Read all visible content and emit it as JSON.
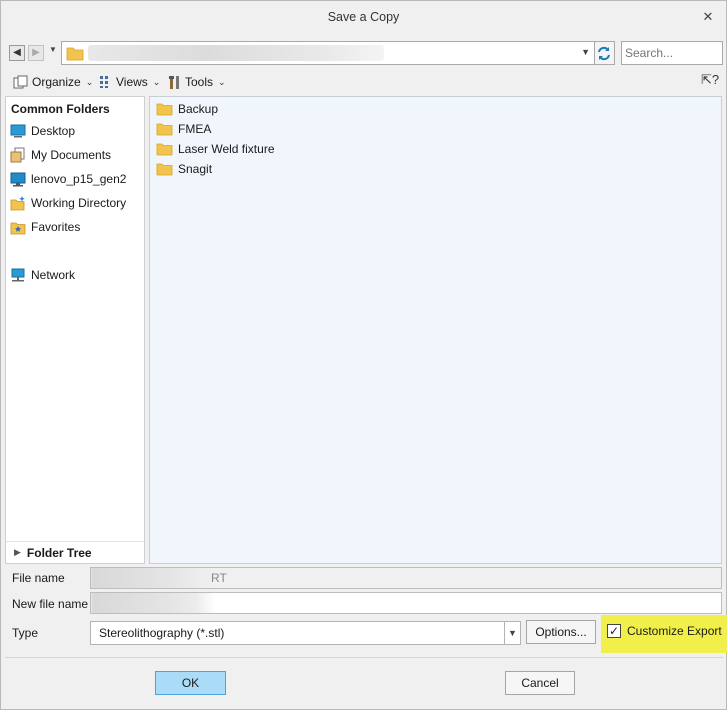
{
  "window": {
    "title": "Save a Copy",
    "close_glyph": "✕"
  },
  "nav": {
    "back_glyph": "◀",
    "forward_glyph": "▶",
    "history_dropdown_glyph": "▼",
    "address_dropdown_glyph": "▼",
    "search_placeholder": "Search..."
  },
  "toolbar": {
    "organize": "Organize",
    "views": "Views",
    "tools": "Tools",
    "chevron": "⌄",
    "help_glyph": "⇱?"
  },
  "left_pane": {
    "heading": "Common Folders",
    "items": [
      {
        "label": "Desktop",
        "icon": "desktop-icon"
      },
      {
        "label": "My Documents",
        "icon": "documents-icon"
      },
      {
        "label": "lenovo_p15_gen2",
        "icon": "computer-icon"
      },
      {
        "label": "Working Directory",
        "icon": "working-directory-icon"
      },
      {
        "label": "Favorites",
        "icon": "favorites-icon"
      },
      {
        "label": "Network",
        "icon": "network-icon"
      }
    ],
    "folder_tree": "Folder Tree",
    "folder_tree_glyph": "▶"
  },
  "files": [
    {
      "name": "Backup",
      "icon": "folder-icon"
    },
    {
      "name": "FMEA",
      "icon": "folder-icon"
    },
    {
      "name": "Laser Weld fixture",
      "icon": "folder-icon"
    },
    {
      "name": "Snagit",
      "icon": "folder-icon"
    }
  ],
  "form": {
    "file_name_label": "File name",
    "file_name_value_tail": "RT",
    "new_file_name_label": "New file name",
    "new_file_name_value": "",
    "type_label": "Type",
    "type_value": "Stereolithography (*.stl)",
    "type_dropdown_glyph": "▼",
    "options_button": "Options...",
    "customize_export_label": "Customize Export",
    "customize_export_checked_glyph": "✓"
  },
  "buttons": {
    "ok": "OK",
    "cancel": "Cancel"
  },
  "colors": {
    "highlight": "#f1f04b",
    "folder": "#f2c34d",
    "ok_button": "#aadcf7",
    "file_pane_bg": "#f0f6fb"
  }
}
